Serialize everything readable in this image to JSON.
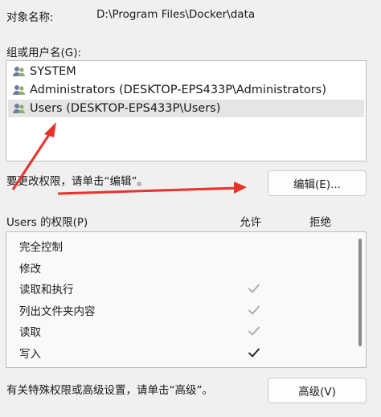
{
  "object": {
    "label": "对象名称:",
    "value": "D:\\Program Files\\Docker\\data"
  },
  "groups": {
    "label": "组或用户名(G):",
    "items": [
      {
        "label": "SYSTEM",
        "icon": "users-icon",
        "selected": false
      },
      {
        "label": "Administrators (DESKTOP-EPS433P\\Administrators)",
        "icon": "users-icon",
        "selected": false
      },
      {
        "label": "Users (DESKTOP-EPS433P\\Users)",
        "icon": "users-icon",
        "selected": true
      }
    ]
  },
  "change_hint": "要更改权限，请单击“编辑”。",
  "edit_button": "编辑(E)...",
  "permissions": {
    "header": "Users 的权限(P)",
    "allow_label": "允许",
    "deny_label": "拒绝",
    "rows": [
      {
        "name": "完全控制",
        "allow": "none"
      },
      {
        "name": "修改",
        "allow": "none"
      },
      {
        "name": "读取和执行",
        "allow": "inherited"
      },
      {
        "name": "列出文件夹内容",
        "allow": "inherited"
      },
      {
        "name": "读取",
        "allow": "inherited"
      },
      {
        "name": "写入",
        "allow": "explicit"
      }
    ]
  },
  "advanced_hint": "有关特殊权限或高级设置，请单击“高级”。",
  "advanced_button": "高级(V)",
  "colors": {
    "annotation_arrow": "#e8322a",
    "check_inherited": "#a8a8a8",
    "check_explicit": "#1a1a1a"
  }
}
